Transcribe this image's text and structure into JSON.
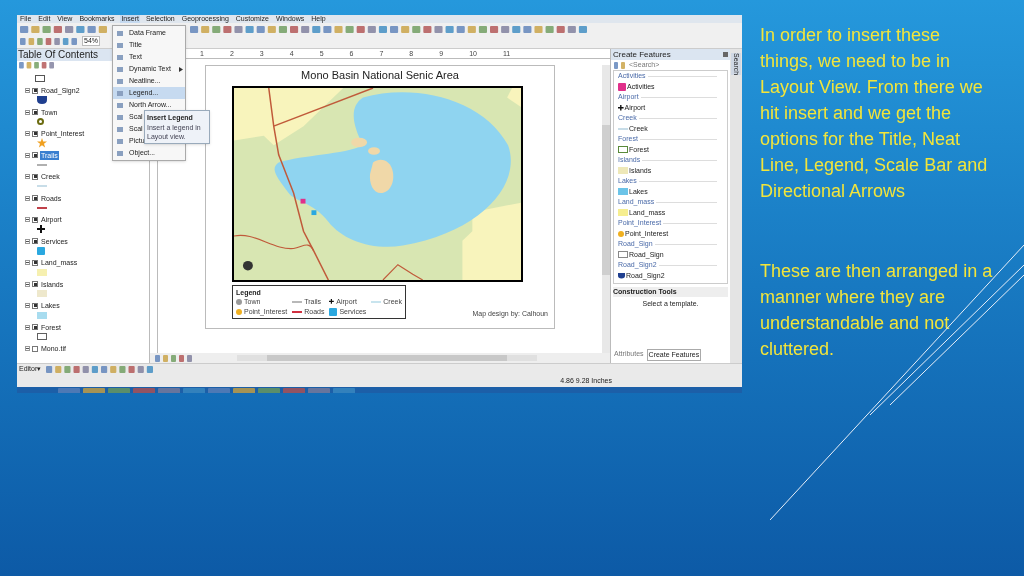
{
  "slide": {
    "paragraphs": [
      "In order to insert these things, we need to be in Layout View. From there we hit insert and we get the options for the Title, Neat Line, Legend, Scale Bar and Directional Arrows",
      "These are then arranged in a manner where they are understandable and not cluttered."
    ]
  },
  "menu_bar": [
    {
      "label": "File",
      "selected": false
    },
    {
      "label": "Edit",
      "selected": false
    },
    {
      "label": "View",
      "selected": false
    },
    {
      "label": "Bookmarks",
      "selected": false
    },
    {
      "label": "Insert",
      "selected": true
    },
    {
      "label": "Selection",
      "selected": false
    },
    {
      "label": "Geoprocessing",
      "selected": false
    },
    {
      "label": "Customize",
      "selected": false
    },
    {
      "label": "Windows",
      "selected": false
    },
    {
      "label": "Help",
      "selected": false
    }
  ],
  "zoom_field": {
    "value": "54%"
  },
  "toc": {
    "title": "Table Of Contents",
    "top_symbol": {
      "kind": "rect",
      "color": "#555555"
    },
    "layers": [
      {
        "name": "Road_Sign2",
        "checked": true,
        "selected": false,
        "kind": "shield",
        "color": "#1f3f8f"
      },
      {
        "name": "Town",
        "checked": true,
        "selected": false,
        "kind": "ring",
        "color": "#6b6b10"
      },
      {
        "name": "Point_Interest",
        "checked": true,
        "selected": false,
        "kind": "star",
        "color": "#f0a020"
      },
      {
        "name": "Trails",
        "checked": true,
        "selected": true,
        "kind": "line",
        "color": "#b0b0b0"
      },
      {
        "name": "Creek",
        "checked": true,
        "selected": false,
        "kind": "line",
        "color": "#c8dde8"
      },
      {
        "name": "Roads",
        "checked": true,
        "selected": false,
        "kind": "line",
        "color": "#c0404a"
      },
      {
        "name": "Airport",
        "checked": true,
        "selected": false,
        "kind": "cross",
        "color": "#111111"
      },
      {
        "name": "Services",
        "checked": true,
        "selected": false,
        "kind": "square",
        "color": "#2aa8e0"
      },
      {
        "name": "Land_mass",
        "checked": true,
        "selected": false,
        "kind": "fill",
        "color": "#f6f0b0"
      },
      {
        "name": "Islands",
        "checked": true,
        "selected": false,
        "kind": "fill",
        "color": "#eee8cc"
      },
      {
        "name": "Lakes",
        "checked": true,
        "selected": false,
        "kind": "fill",
        "color": "#a8dcef"
      },
      {
        "name": "Forest",
        "checked": true,
        "selected": false,
        "kind": "rect",
        "color": "#606060"
      },
      {
        "name": "Mono.tif",
        "checked": false,
        "selected": false
      }
    ]
  },
  "insert_menu": {
    "items": [
      {
        "label": "Data Frame",
        "selected": false,
        "submenu": false
      },
      {
        "label": "Title",
        "selected": false,
        "submenu": false
      },
      {
        "label": "Text",
        "selected": false,
        "submenu": false
      },
      {
        "label": "Dynamic Text",
        "selected": false,
        "submenu": true
      },
      {
        "label": "Neatline...",
        "selected": false,
        "submenu": false
      },
      {
        "label": "Legend...",
        "selected": true,
        "submenu": false
      },
      {
        "label": "North Arrow...",
        "selected": false,
        "submenu": false
      },
      {
        "label": "Scal",
        "selected": false,
        "submenu": false
      },
      {
        "label": "Scal",
        "selected": false,
        "submenu": false
      },
      {
        "label": "Pictu",
        "selected": false,
        "submenu": false
      },
      {
        "label": "Object...",
        "selected": false,
        "submenu": false
      }
    ],
    "tooltip": {
      "title": "Insert Legend",
      "text": "Insert a legend in Layout view."
    }
  },
  "ruler": {
    "labels": [
      "1",
      "2",
      "3",
      "4",
      "5",
      "6",
      "7",
      "8",
      "9",
      "10",
      "11"
    ]
  },
  "layout_page": {
    "title": "Mono Basin National Senic Area",
    "legend": {
      "title": "Legend",
      "items": [
        {
          "label": "Town",
          "kind": "dot",
          "color": "#9a9a9a"
        },
        {
          "label": "Trails",
          "kind": "line",
          "color": "#b8b8b8"
        },
        {
          "label": "Airport",
          "kind": "cross",
          "color": "#111111"
        },
        {
          "label": "Creek",
          "kind": "line",
          "color": "#c8e4ee"
        },
        {
          "label": "Point_Interest",
          "kind": "dot",
          "color": "#f0b020"
        },
        {
          "label": "Roads",
          "kind": "line",
          "color": "#d03040"
        },
        {
          "label": "Services",
          "kind": "square",
          "color": "#2aa8e0"
        }
      ]
    },
    "credit": "Map design by: Calhoun"
  },
  "create_features": {
    "title": "Create Features",
    "search": {
      "placeholder": "<Search>"
    },
    "groups": [
      {
        "header": "Activities",
        "template": "Activities",
        "kind": "square",
        "color": "#e0308a"
      },
      {
        "header": "Airport",
        "template": "Airport",
        "kind": "cross",
        "color": "#111111"
      },
      {
        "header": "Creek",
        "template": "Creek",
        "kind": "line",
        "color": "#c8dde8"
      },
      {
        "header": "Forest",
        "template": "Forest",
        "kind": "rect",
        "color": "#5a8a3a"
      },
      {
        "header": "Islands",
        "template": "Islands",
        "kind": "fill",
        "color": "#eee8b8"
      },
      {
        "header": "Lakes",
        "template": "Lakes",
        "kind": "fill",
        "color": "#6cc4e8"
      },
      {
        "header": "Land_mass",
        "template": "Land_mass",
        "kind": "fill",
        "color": "#f6ee90"
      },
      {
        "header": "Point_Interest",
        "template": "Point_Interest",
        "kind": "dot",
        "color": "#f0b020"
      },
      {
        "header": "Road_Sign",
        "template": "Road_Sign",
        "kind": "rect",
        "color": "#888888"
      },
      {
        "header": "Road_Sign2",
        "template": "Road_Sign2",
        "kind": "shield",
        "color": "#1f3f8f"
      }
    ],
    "construction_tools": {
      "title": "Construction Tools",
      "hint": "Select a template."
    },
    "tabs": [
      {
        "label": "Attributes",
        "selected": false
      },
      {
        "label": "Create Features",
        "selected": true
      }
    ]
  },
  "side_tab": {
    "label": "Search"
  },
  "editor_toolbar": {
    "label": "Editor▾"
  },
  "status_bar": {
    "coordinates": "4.86  9.28 Inches"
  }
}
